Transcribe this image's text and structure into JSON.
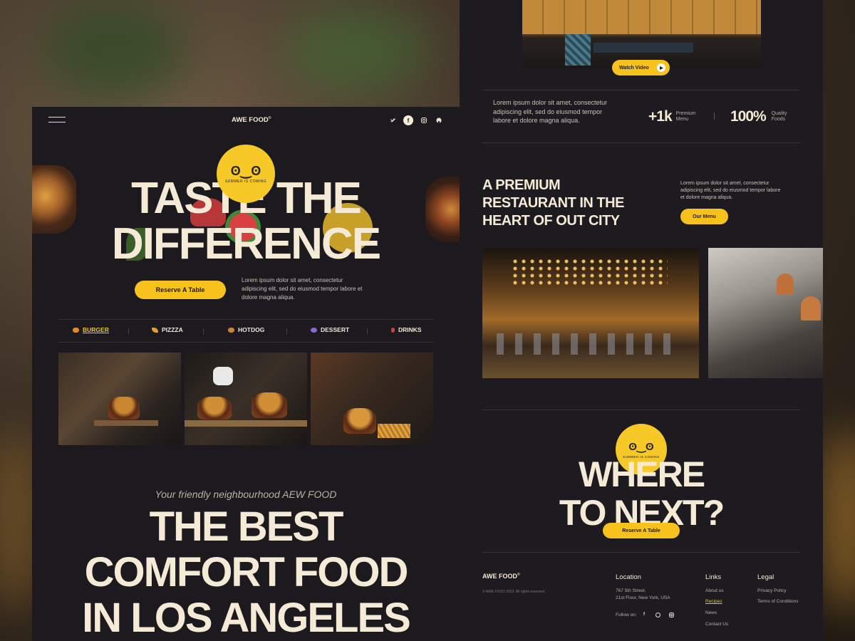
{
  "brand": {
    "name": "AWE FOOD",
    "mark": "©"
  },
  "nav": {
    "social_icons": [
      "twitter-icon",
      "facebook-icon",
      "instagram-icon",
      "github-icon"
    ]
  },
  "hero": {
    "line1": "TASTE THE",
    "line2": "DIFFERENCE",
    "cta_label": "Reserve A Table",
    "description": "Lorem ipsum dolor sit amet, consectetur adipiscing elit, sed do eiusmod tempor labore et dolore magna aliqua."
  },
  "sticker_text": "SUMMER IS COMING",
  "categories": [
    {
      "label": "BURGER",
      "active": true,
      "icon": "burger-icon",
      "color": "#e08a2a"
    },
    {
      "label": "PIZZZA",
      "active": false,
      "icon": "pizza-icon",
      "color": "#e0a03a"
    },
    {
      "label": "HOTDOG",
      "active": false,
      "icon": "hotdog-icon",
      "color": "#c9823c"
    },
    {
      "label": "DESSERT",
      "active": false,
      "icon": "dessert-icon",
      "color": "#8a6ad0"
    },
    {
      "label": "DRINKS",
      "active": false,
      "icon": "drinks-icon",
      "color": "#c8433a"
    }
  ],
  "intro": {
    "tagline": "Your friendly neighbourhood AEW FOOD",
    "line1": "THE BEST",
    "line2": "COMFORT FOOD",
    "line3": "IN LOS ANGELES"
  },
  "video": {
    "label": "Watch Video"
  },
  "stats": {
    "description": "Lorem ipsum dolor sit amet, consectetur adipiscing elit, sed do eiusmod tempor labore et dolore magna aliqua.",
    "items": [
      {
        "value": "+1k",
        "label1": "Premium",
        "label2": "Menu"
      },
      {
        "value": "100%",
        "label1": "Quality",
        "label2": "Foods"
      }
    ]
  },
  "premium": {
    "line1": "A PREMIUM",
    "line2": "RESTAURANT IN THE",
    "line3": "HEART OF OUT CITY",
    "description": "Lorem ipsum dolor sit amet, consectetur adipiscing elit, sed do eiusmod tempor labore et dolore magna aliqua.",
    "cta_label": "Our Menu"
  },
  "where": {
    "line1": "WHERE",
    "line2": "TO NEXT?",
    "cta_label": "Reserve A Table"
  },
  "footer": {
    "brand": "AWE FOOD",
    "copyright": "© AWE FOOD 2023, All rights reserved.",
    "location_title": "Location",
    "address1": "767 5th Street,",
    "address2": "21st Floor, New York, USA",
    "follow_label": "Follow on:",
    "links_title": "Links",
    "links": [
      "About us",
      "Recipes",
      "News",
      "Contact Us"
    ],
    "legal_title": "Legal",
    "legal": [
      "Privacy Policy",
      "Terms of Conditions"
    ]
  },
  "colors": {
    "accent": "#f6c21b",
    "panel": "#1c1a1f",
    "cream": "#f5ead6"
  }
}
